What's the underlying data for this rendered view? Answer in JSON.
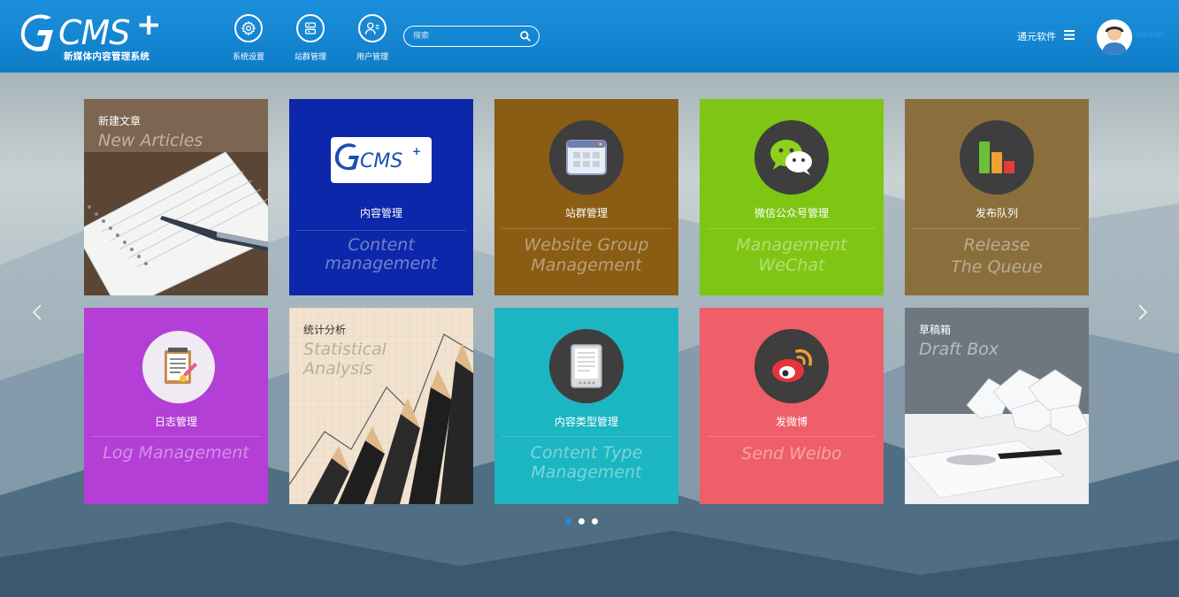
{
  "header": {
    "logo_text": "CMS",
    "logo_plus": "+",
    "logo_subtitle": "新媒体内容管理系统",
    "nav": [
      {
        "label": "系统设置",
        "icon": "gear-icon"
      },
      {
        "label": "站群管理",
        "icon": "server-icon"
      },
      {
        "label": "用户管理",
        "icon": "user-manage-icon"
      }
    ],
    "search_placeholder": "搜索",
    "company": "通元软件",
    "username": "admin"
  },
  "tiles": [
    {
      "cn": "新建文章",
      "en": "New Articles",
      "bg": "#6f5a48",
      "style": "photo"
    },
    {
      "cn": "内容管理",
      "en1": "Content",
      "en2": "management",
      "bg": "#0c27a9",
      "icon": "gcms-logo-icon"
    },
    {
      "cn": "站群管理",
      "en1": "Website Group",
      "en2": "Management",
      "bg": "#8a5c14",
      "icon": "website-window-icon"
    },
    {
      "cn": "微信公众号管理",
      "en1": "Management",
      "en2": "WeChat",
      "bg": "#7ec613",
      "icon": "wechat-icon"
    },
    {
      "cn": "发布队列",
      "en1": "Release",
      "en2": "The Queue",
      "bg": "#8a6f3d",
      "icon": "queue-bars-icon"
    },
    {
      "cn": "日志管理",
      "en1": "Log Management",
      "bg": "#b33fd6",
      "icon": "notepad-icon"
    },
    {
      "cn": "统计分析",
      "en1": "Statistical",
      "en2": "Analysis",
      "bg": "#e9d8c2",
      "style": "photo"
    },
    {
      "cn": "内容类型管理",
      "en1": "Content Type",
      "en2": "Management",
      "bg": "#1cb5c2",
      "icon": "tablet-icon"
    },
    {
      "cn": "发微博",
      "en1": "Send Weibo",
      "bg": "#ee5f69",
      "icon": "weibo-icon"
    },
    {
      "cn": "草稿箱",
      "en": "Draft Box",
      "bg": "#7e8790",
      "style": "photo"
    }
  ],
  "carousel": {
    "pages": 3,
    "active": 0
  },
  "colors": {
    "header": "#1288d6",
    "accent": "#1e8fe0"
  }
}
